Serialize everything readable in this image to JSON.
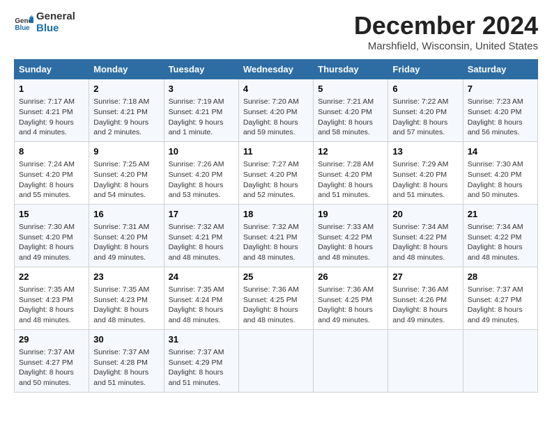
{
  "header": {
    "logo_general": "General",
    "logo_blue": "Blue",
    "title": "December 2024",
    "subtitle": "Marshfield, Wisconsin, United States"
  },
  "weekdays": [
    "Sunday",
    "Monday",
    "Tuesday",
    "Wednesday",
    "Thursday",
    "Friday",
    "Saturday"
  ],
  "weeks": [
    [
      {
        "day": "1",
        "detail": "Sunrise: 7:17 AM\nSunset: 4:21 PM\nDaylight: 9 hours\nand 4 minutes."
      },
      {
        "day": "2",
        "detail": "Sunrise: 7:18 AM\nSunset: 4:21 PM\nDaylight: 9 hours\nand 2 minutes."
      },
      {
        "day": "3",
        "detail": "Sunrise: 7:19 AM\nSunset: 4:21 PM\nDaylight: 9 hours\nand 1 minute."
      },
      {
        "day": "4",
        "detail": "Sunrise: 7:20 AM\nSunset: 4:20 PM\nDaylight: 8 hours\nand 59 minutes."
      },
      {
        "day": "5",
        "detail": "Sunrise: 7:21 AM\nSunset: 4:20 PM\nDaylight: 8 hours\nand 58 minutes."
      },
      {
        "day": "6",
        "detail": "Sunrise: 7:22 AM\nSunset: 4:20 PM\nDaylight: 8 hours\nand 57 minutes."
      },
      {
        "day": "7",
        "detail": "Sunrise: 7:23 AM\nSunset: 4:20 PM\nDaylight: 8 hours\nand 56 minutes."
      }
    ],
    [
      {
        "day": "8",
        "detail": "Sunrise: 7:24 AM\nSunset: 4:20 PM\nDaylight: 8 hours\nand 55 minutes."
      },
      {
        "day": "9",
        "detail": "Sunrise: 7:25 AM\nSunset: 4:20 PM\nDaylight: 8 hours\nand 54 minutes."
      },
      {
        "day": "10",
        "detail": "Sunrise: 7:26 AM\nSunset: 4:20 PM\nDaylight: 8 hours\nand 53 minutes."
      },
      {
        "day": "11",
        "detail": "Sunrise: 7:27 AM\nSunset: 4:20 PM\nDaylight: 8 hours\nand 52 minutes."
      },
      {
        "day": "12",
        "detail": "Sunrise: 7:28 AM\nSunset: 4:20 PM\nDaylight: 8 hours\nand 51 minutes."
      },
      {
        "day": "13",
        "detail": "Sunrise: 7:29 AM\nSunset: 4:20 PM\nDaylight: 8 hours\nand 51 minutes."
      },
      {
        "day": "14",
        "detail": "Sunrise: 7:30 AM\nSunset: 4:20 PM\nDaylight: 8 hours\nand 50 minutes."
      }
    ],
    [
      {
        "day": "15",
        "detail": "Sunrise: 7:30 AM\nSunset: 4:20 PM\nDaylight: 8 hours\nand 49 minutes."
      },
      {
        "day": "16",
        "detail": "Sunrise: 7:31 AM\nSunset: 4:20 PM\nDaylight: 8 hours\nand 49 minutes."
      },
      {
        "day": "17",
        "detail": "Sunrise: 7:32 AM\nSunset: 4:21 PM\nDaylight: 8 hours\nand 48 minutes."
      },
      {
        "day": "18",
        "detail": "Sunrise: 7:32 AM\nSunset: 4:21 PM\nDaylight: 8 hours\nand 48 minutes."
      },
      {
        "day": "19",
        "detail": "Sunrise: 7:33 AM\nSunset: 4:22 PM\nDaylight: 8 hours\nand 48 minutes."
      },
      {
        "day": "20",
        "detail": "Sunrise: 7:34 AM\nSunset: 4:22 PM\nDaylight: 8 hours\nand 48 minutes."
      },
      {
        "day": "21",
        "detail": "Sunrise: 7:34 AM\nSunset: 4:22 PM\nDaylight: 8 hours\nand 48 minutes."
      }
    ],
    [
      {
        "day": "22",
        "detail": "Sunrise: 7:35 AM\nSunset: 4:23 PM\nDaylight: 8 hours\nand 48 minutes."
      },
      {
        "day": "23",
        "detail": "Sunrise: 7:35 AM\nSunset: 4:23 PM\nDaylight: 8 hours\nand 48 minutes."
      },
      {
        "day": "24",
        "detail": "Sunrise: 7:35 AM\nSunset: 4:24 PM\nDaylight: 8 hours\nand 48 minutes."
      },
      {
        "day": "25",
        "detail": "Sunrise: 7:36 AM\nSunset: 4:25 PM\nDaylight: 8 hours\nand 48 minutes."
      },
      {
        "day": "26",
        "detail": "Sunrise: 7:36 AM\nSunset: 4:25 PM\nDaylight: 8 hours\nand 49 minutes."
      },
      {
        "day": "27",
        "detail": "Sunrise: 7:36 AM\nSunset: 4:26 PM\nDaylight: 8 hours\nand 49 minutes."
      },
      {
        "day": "28",
        "detail": "Sunrise: 7:37 AM\nSunset: 4:27 PM\nDaylight: 8 hours\nand 49 minutes."
      }
    ],
    [
      {
        "day": "29",
        "detail": "Sunrise: 7:37 AM\nSunset: 4:27 PM\nDaylight: 8 hours\nand 50 minutes."
      },
      {
        "day": "30",
        "detail": "Sunrise: 7:37 AM\nSunset: 4:28 PM\nDaylight: 8 hours\nand 51 minutes."
      },
      {
        "day": "31",
        "detail": "Sunrise: 7:37 AM\nSunset: 4:29 PM\nDaylight: 8 hours\nand 51 minutes."
      },
      {
        "day": "",
        "detail": ""
      },
      {
        "day": "",
        "detail": ""
      },
      {
        "day": "",
        "detail": ""
      },
      {
        "day": "",
        "detail": ""
      }
    ]
  ]
}
